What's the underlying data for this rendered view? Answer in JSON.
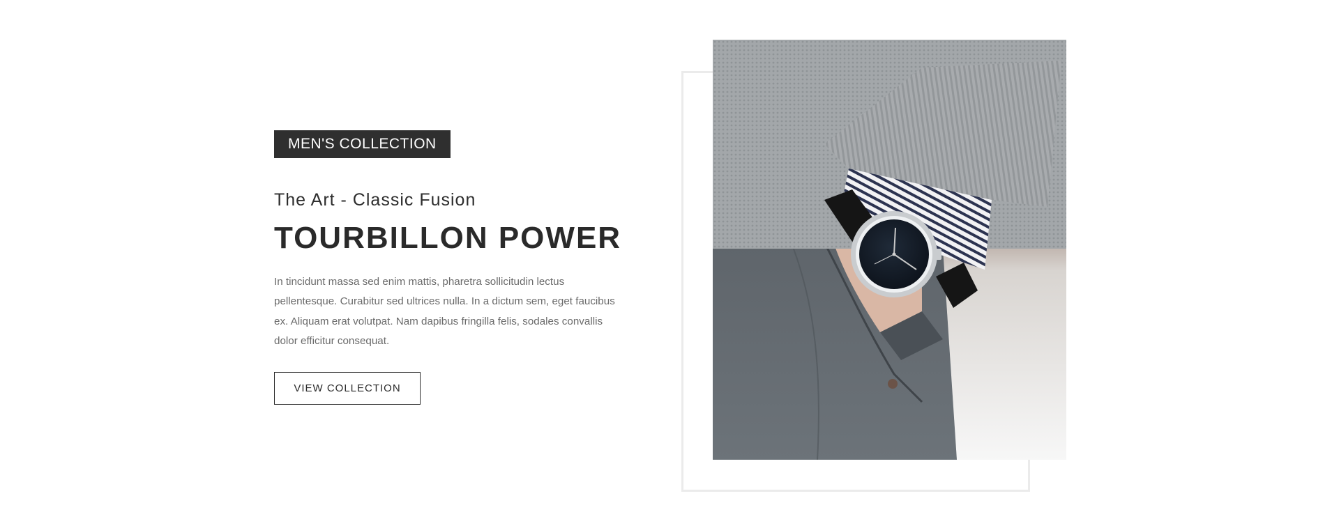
{
  "hero": {
    "badge": "MEN'S COLLECTION",
    "subtitle": "The Art - Classic Fusion",
    "title": "TOURBILLON POWER",
    "description": "In tincidunt massa sed enim mattis, pharetra sollicitudin lectus pellentesque. Curabitur sed ultrices nulla. In a dictum sem, eget faucibus ex. Aliquam erat volutpat. Nam dapibus fringilla felis, sodales convallis dolor efficitur consequat.",
    "cta_label": "VIEW COLLECTION"
  },
  "colors": {
    "badge_bg": "#2f2f2f",
    "heading": "#2a2a2a",
    "body": "#6a6a6a",
    "frame_border": "#ebebeb",
    "background": "#ffffff"
  },
  "icons": {
    "photo": "wristwatch-photo"
  }
}
